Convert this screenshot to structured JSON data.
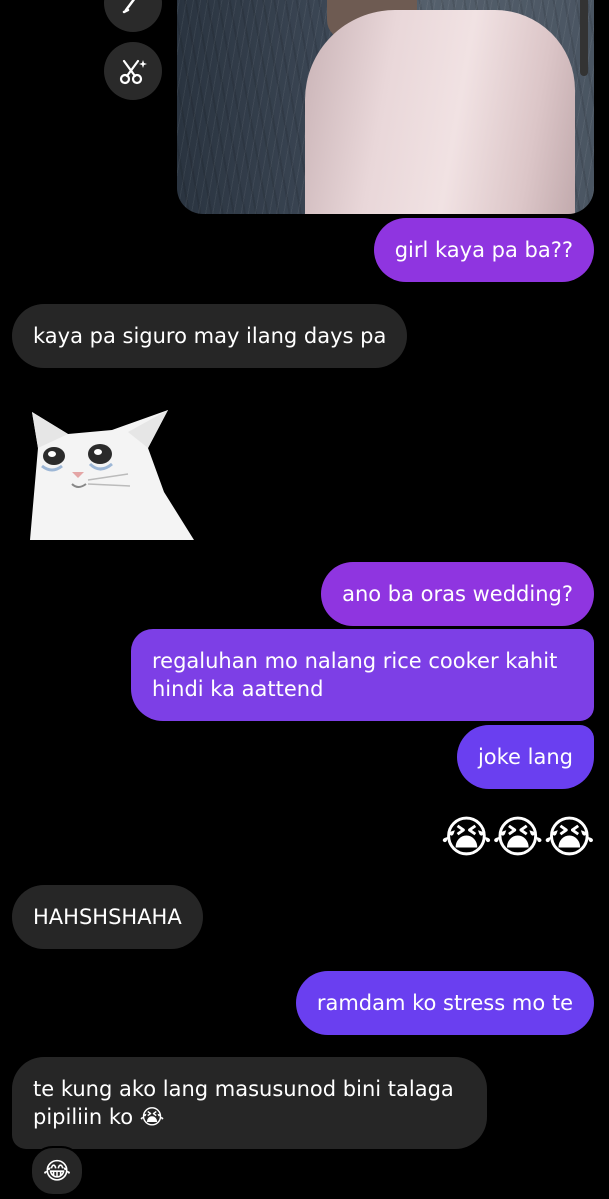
{
  "toolbar": {
    "buttons": [
      {
        "icon": "pencil-icon"
      },
      {
        "icon": "scissors-sparkle-icon"
      }
    ]
  },
  "messages": [
    {
      "side": "sent",
      "text": "girl kaya pa ba??"
    },
    {
      "side": "received",
      "text": "kaya pa siguro may ilang days pa"
    },
    {
      "side": "received",
      "type": "sticker",
      "icon": "crying-cat-sticker"
    },
    {
      "side": "sent",
      "text": "ano ba oras wedding?"
    },
    {
      "side": "sent",
      "line1": "regaluhan mo nalang rice cooker kahit",
      "line2": "hindi ka aattend"
    },
    {
      "side": "sent",
      "text": "joke lang"
    },
    {
      "side": "sent",
      "type": "emoji",
      "text": "😭😭😭"
    },
    {
      "side": "received",
      "text": "HAHSHSHAHA"
    },
    {
      "side": "sent",
      "text": "ramdam ko stress mo te"
    },
    {
      "side": "received",
      "line1": "te kung ako lang masusunod bini talaga",
      "line2": "pipiliin ko 😭"
    }
  ],
  "reaction": {
    "emoji": "😂"
  },
  "colors": {
    "background": "#000000",
    "received_bubble": "#262626",
    "sent_bubble_top": "#8f35e0",
    "sent_bubble_bottom": "#6a3ff0"
  }
}
